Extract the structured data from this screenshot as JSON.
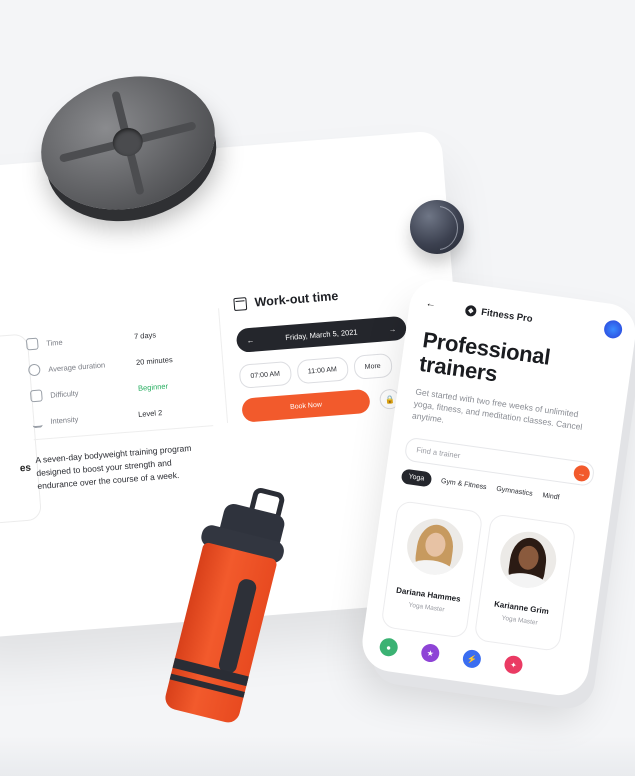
{
  "details": {
    "stats": [
      {
        "icon": "clock-icon",
        "label": "Time",
        "value": "7 days",
        "highlight": false
      },
      {
        "icon": "timer-icon",
        "label": "Average duration",
        "value": "20 minutes",
        "highlight": false
      },
      {
        "icon": "gauge-icon",
        "label": "Difficulty",
        "value": "Beginner",
        "highlight": true
      },
      {
        "icon": "bars-icon",
        "label": "Intensity",
        "value": "Level 2",
        "highlight": false
      }
    ],
    "description": "A seven-day bodyweight training program designed to boost your strength and endurance over the course of a week.",
    "side_panel_text": "es"
  },
  "workout": {
    "title": "Work-out time",
    "date": "Friday, March 5, 2021",
    "times": [
      "07:00 AM",
      "11:00 AM",
      "More"
    ],
    "book_label": "Book Now"
  },
  "phone": {
    "brand": "Fitness Pro",
    "title_line1": "Professional",
    "title_line2": "trainers",
    "subtitle": "Get started with two free weeks of unlimited yoga, fitness, and meditation classes. Cancel anytime.",
    "search_placeholder": "Find a trainer",
    "tabs": [
      "Yoga",
      "Gym & Fitness",
      "Gymnastics",
      "Mindf"
    ],
    "active_tab": "Yoga",
    "trainers": [
      {
        "name": "Dariana Hammes",
        "role": "Yoga Master"
      },
      {
        "name": "Karianne Grim",
        "role": "Yoga Master"
      }
    ],
    "nav_icons": [
      "user-icon",
      "medal-icon",
      "bolt-icon",
      "footprints-icon"
    ]
  },
  "colors": {
    "accent": "#f25a2c",
    "dark": "#24262c",
    "success": "#27ae60",
    "nav": [
      "#3bb273",
      "#8e44d6",
      "#3a6df0",
      "#ea3a63"
    ]
  }
}
